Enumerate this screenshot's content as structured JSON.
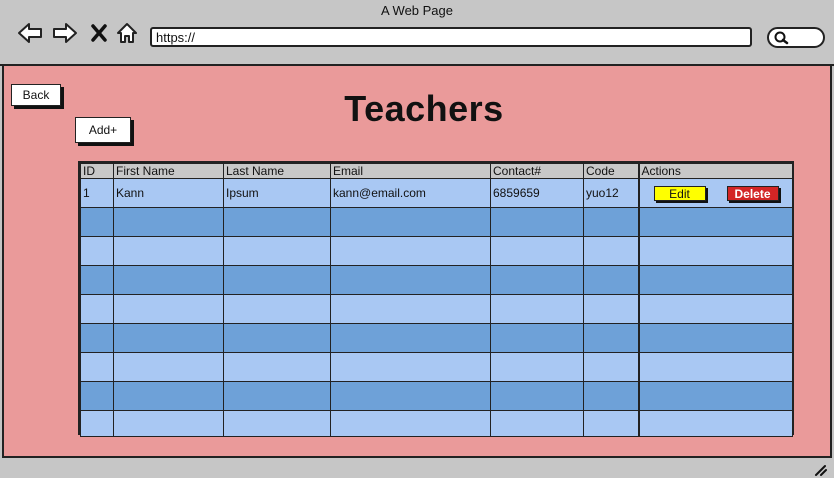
{
  "window": {
    "title": "A Web Page"
  },
  "browser": {
    "url": "https://"
  },
  "page": {
    "back_label": "Back",
    "add_label": "Add+",
    "title": "Teachers"
  },
  "table": {
    "headers": [
      "ID",
      "First Name",
      "Last Name",
      "Email",
      "Contact#",
      "Code",
      "Actions"
    ],
    "rows": [
      {
        "id": "1",
        "first_name": "Kann",
        "last_name": "Ipsum",
        "email": "kann@email.com",
        "contact": "6859659",
        "code": "yuo12"
      }
    ],
    "edit_label": "Edit",
    "delete_label": "Delete"
  },
  "colors": {
    "page_bg": "#ea9a9a",
    "row_light": "#a9c8f3",
    "row_dark": "#6ea1d8",
    "edit": "#ffff00",
    "delete": "#d32525"
  },
  "icons": [
    "back-arrow-icon",
    "forward-arrow-icon",
    "close-icon",
    "home-icon",
    "search-icon",
    "resize-grip-icon"
  ]
}
